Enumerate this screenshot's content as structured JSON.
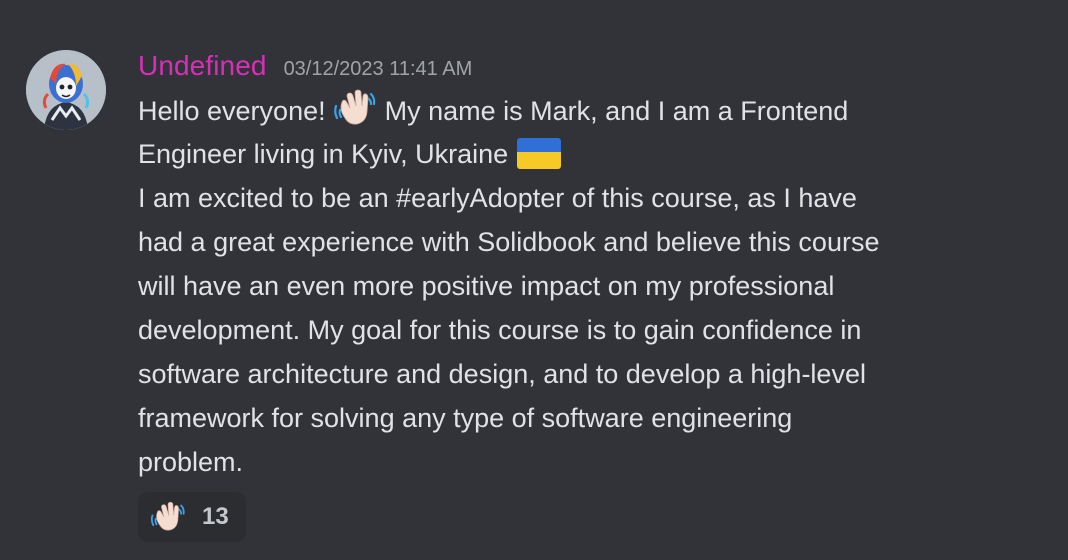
{
  "message": {
    "author": "Undefined",
    "timestamp": "03/12/2023 11:41 AM",
    "avatar_icon": "astronaut-avatar",
    "lines": [
      "Hello everyone!",
      "My name is Mark, and I am a Frontend",
      "Engineer living in Kyiv, Ukraine",
      "I am excited to be an #earlyAdopter of this course, as I have",
      "had a great experience with Solidbook and believe this course",
      "will have an even more positive impact on my professional",
      "development. My goal for this course is to gain confidence in",
      "software architecture and design, and to develop a high-level",
      "framework for solving any type of software engineering",
      "problem."
    ],
    "inline_emojis": [
      "waving-hand-icon",
      "ukraine-flag-icon"
    ]
  },
  "reaction": {
    "emoji": "waving-hand-icon",
    "count": "13"
  },
  "colors": {
    "background": "#313338",
    "username": "#d82fb8",
    "text": "#e0e2e5",
    "timestamp": "#a0a3a8",
    "reaction_bg": "#2b2d31"
  }
}
